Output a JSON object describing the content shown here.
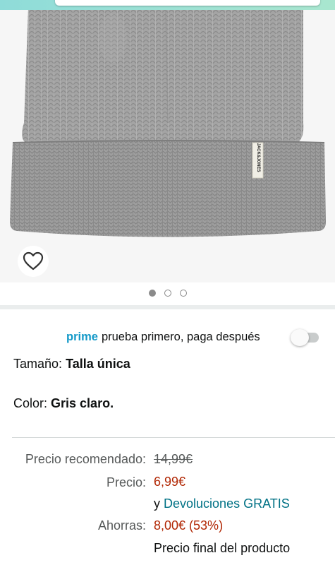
{
  "gallery": {
    "product_label_text": "JACK&JONES",
    "favorite_icon": "heart-outline-icon",
    "dots": [
      true,
      false,
      false
    ]
  },
  "prime": {
    "brand": "prime",
    "tagline": "prueba primero, paga después",
    "toggle_on": false
  },
  "attributes": {
    "size_label": "Tamaño:",
    "size_value": "Talla única",
    "color_label": "Color:",
    "color_value": "Gris claro."
  },
  "pricing": {
    "recommended_label": "Precio recomendado:",
    "recommended_value": "14,99€",
    "price_label": "Precio:",
    "price_value": "6,99€",
    "returns_prefix": "y",
    "returns_link": "Devoluciones GRATIS",
    "savings_label": "Ahorras:",
    "savings_value": "8,00€ (53%)",
    "final_price_text": "Precio final del producto"
  },
  "colors": {
    "accent_link": "#007185",
    "price_red": "#b12704",
    "prime_blue": "#1399c8"
  }
}
